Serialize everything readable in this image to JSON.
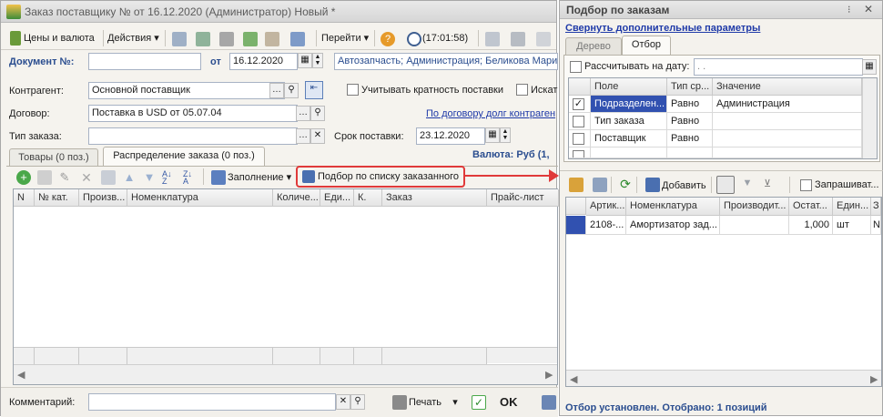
{
  "main_window": {
    "title": "Заказ поставщику №  от 16.12.2020 (Администратор) Новый *",
    "toolbar": {
      "prices_currency": "Цены и валюта",
      "actions": "Действия",
      "goto": "Перейти",
      "time": "(17:01:58)"
    },
    "doc_number_label": "Документ №:",
    "doc_number_value": "",
    "date_from_label": "от",
    "date_value": "16.12.2020",
    "org_info": "Автозапчасть; Администрация; Беликова Мари",
    "contractor_label": "Контрагент:",
    "contractor_value": "Основной поставщик",
    "contract_label": "Договор:",
    "contract_value": "Поставка в USD от 05.07.04",
    "order_type_label": "Тип заказа:",
    "order_type_value": "",
    "multiplicity_label": "Учитывать кратность поставки",
    "search_label": "Искат",
    "debt_link": "По договору долг контраген",
    "delivery_label": "Срок поставки:",
    "delivery_value": "23.12.2020",
    "currency_text": "Валюта: Руб (1,",
    "tabs": [
      "Товары (0 поз.)",
      "Распределение заказа (0 поз.)"
    ],
    "table_toolbar": {
      "fill": "Заполнение",
      "pick_by_list": "Подбор по списку заказанного"
    },
    "columns": [
      "N",
      "№ кат.",
      "Произв...",
      "Номенклатура",
      "Количе...",
      "Еди...",
      "К.",
      "Заказ",
      "Прайс-лист"
    ],
    "comment_label": "Комментарий:",
    "comment_value": "",
    "print": "Печать",
    "ok": "OK"
  },
  "side_panel": {
    "title": "Подбор по заказам",
    "collapse_link": "Свернуть дополнительные параметры",
    "tabs": [
      "Дерево",
      "Отбор"
    ],
    "calc_on_date_label": "Рассчитывать на дату:",
    "calc_on_date_value": ". .",
    "filter_columns": [
      "Поле",
      "Тип ср...",
      "Значение"
    ],
    "filter_rows": [
      {
        "checked": true,
        "field": "Подразделен...",
        "type": "Равно",
        "value": "Администрация"
      },
      {
        "checked": false,
        "field": "Тип заказа",
        "type": "Равно",
        "value": ""
      },
      {
        "checked": false,
        "field": "Поставщик",
        "type": "Равно",
        "value": ""
      },
      {
        "checked": false,
        "field": "",
        "type": "",
        "value": ""
      }
    ],
    "toolbar": {
      "add": "Добавить",
      "ask": "Запрашиват..."
    },
    "result_columns": [
      "Артик...",
      "Номенклатура",
      "Производит...",
      "Остат...",
      "Един...",
      "З"
    ],
    "result_rows": [
      {
        "article": "2108-...",
        "name": "Амортизатор зад...",
        "maker": "",
        "rest": "1,000",
        "unit": "шт",
        "z": "N"
      }
    ],
    "status": "Отбор установлен. Отобрано: 1 позиций"
  },
  "colors": {
    "highlight": "#e03a3a",
    "link": "#1f3aa8",
    "selection": "#3151b0"
  }
}
